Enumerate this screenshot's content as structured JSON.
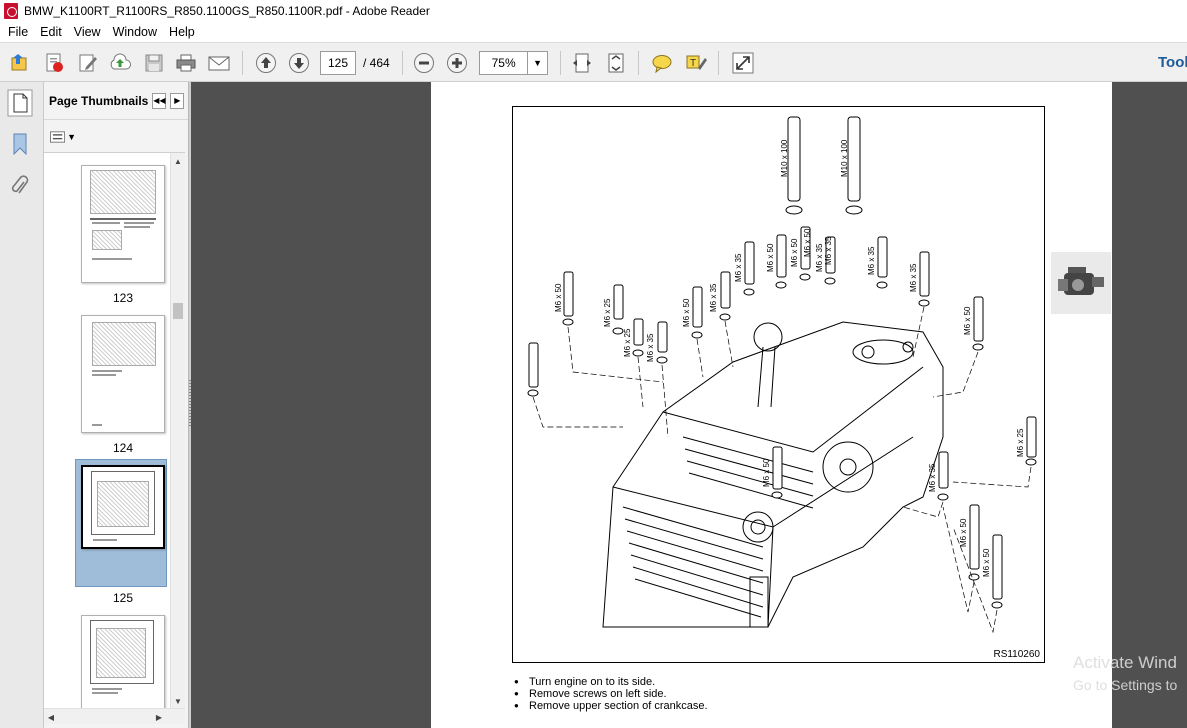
{
  "window": {
    "title": "BMW_K1100RT_R1100RS_R850.1100GS_R850.1100R.pdf - Adobe Reader"
  },
  "menu": [
    "File",
    "Edit",
    "View",
    "Window",
    "Help"
  ],
  "toolbar": {
    "current_page": "125",
    "page_total": "/ 464",
    "zoom": "75%",
    "tools_label": "Tool"
  },
  "thumbnails_panel": {
    "title": "Page Thumbnails",
    "pages": [
      {
        "label": "123"
      },
      {
        "label": "124"
      },
      {
        "label": "125",
        "selected": true
      },
      {
        "label": ""
      }
    ]
  },
  "document": {
    "figure_code": "RS110260",
    "screw_labels": [
      "M10 x 100",
      "M10 x 100",
      "M6 x 50",
      "M6 x 25",
      "M6 x 25",
      "M6 x 35",
      "M6 x 50",
      "M6 x 35",
      "M6 x 35",
      "M6 x 50",
      "M6 x 50",
      "M6 x 50",
      "M6 x 35",
      "M6 x 35",
      "M6 x 35",
      "M6 x 35",
      "M6 x 50",
      "M6 x 25",
      "M6 x 50",
      "M6 x 35",
      "M6 x 50",
      "M6 x 50"
    ],
    "instructions": [
      "Turn engine on to its side.",
      "Remove screws on left side.",
      "Remove upper section of crankcase."
    ]
  },
  "watermark": {
    "line1": "Activate Wind",
    "line2": "Go to Settings to"
  },
  "colors": {
    "doc_background": "#505050",
    "panel_background": "#f3f3f3",
    "tools_accent": "#1d5b99",
    "pdf_icon": "#c8102e"
  }
}
